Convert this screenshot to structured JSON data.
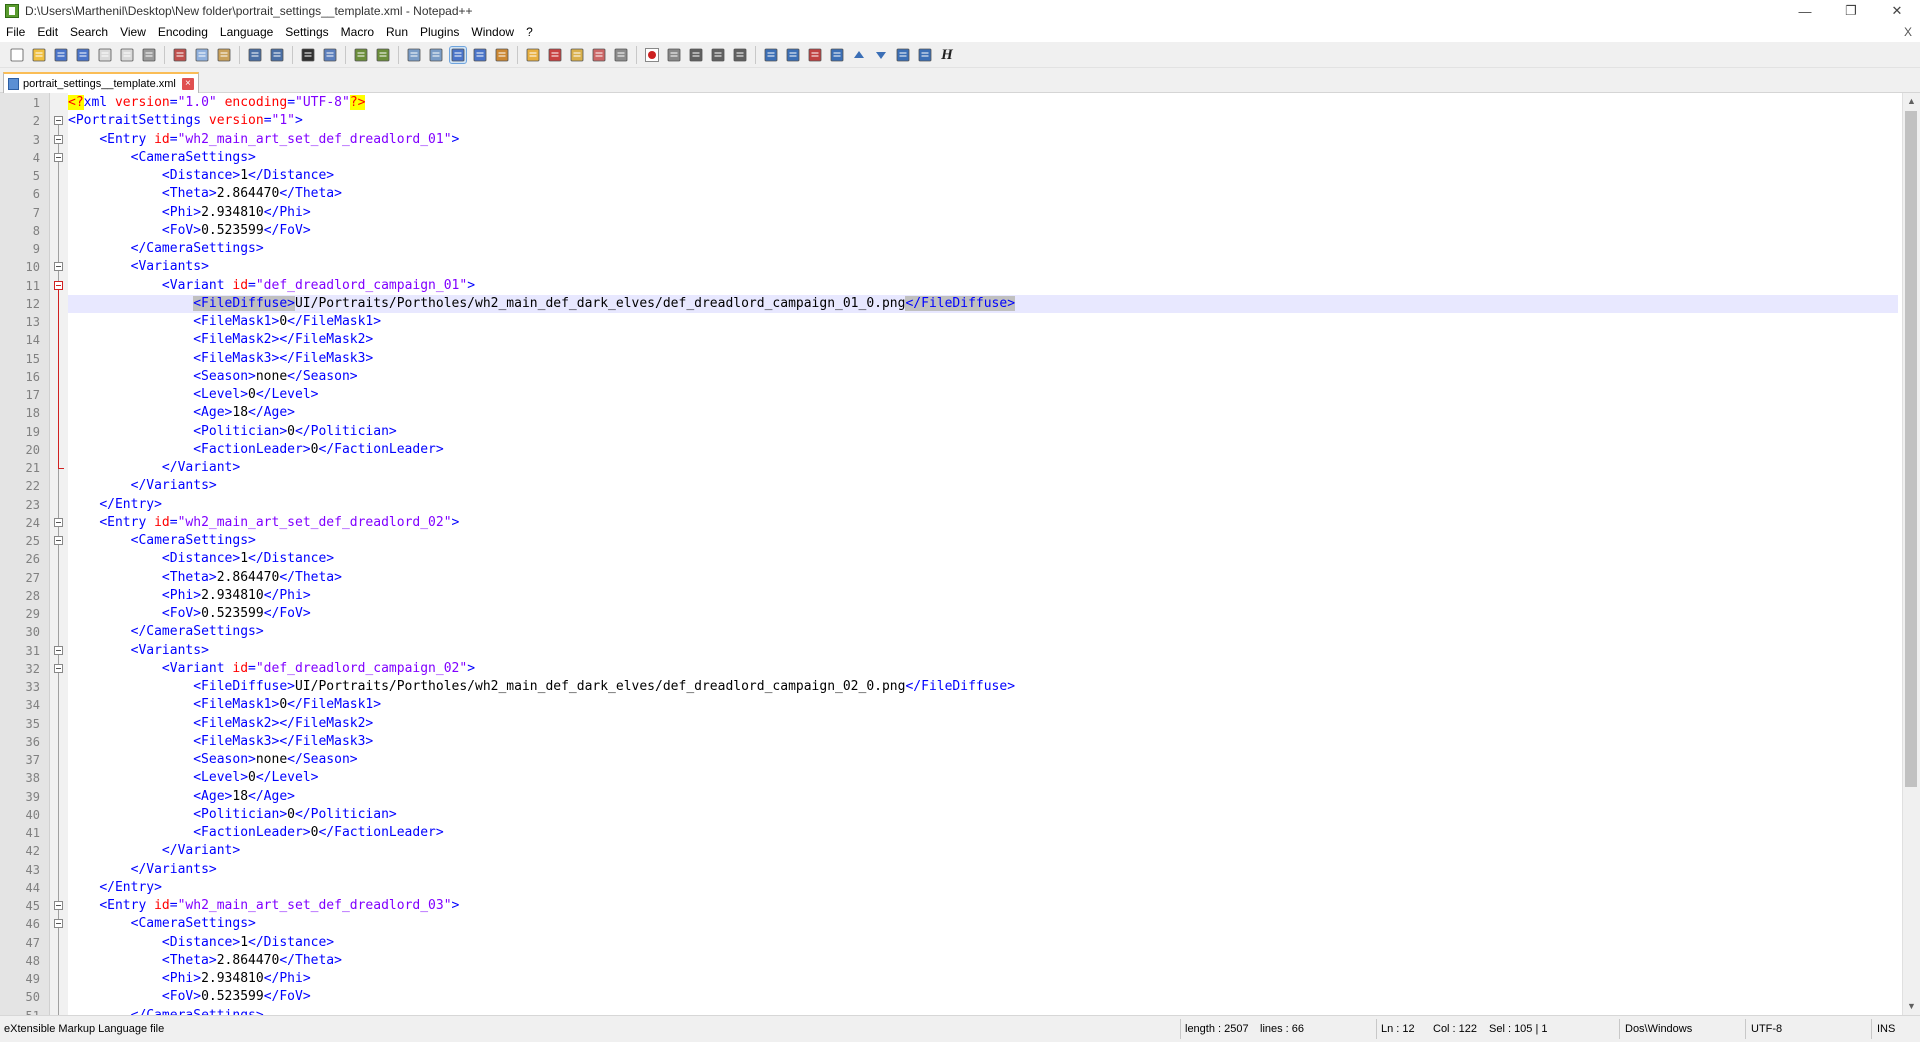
{
  "window": {
    "title": "D:\\Users\\Marthenil\\Desktop\\New folder\\portrait_settings__template.xml - Notepad++",
    "minimize_glyph": "—",
    "restore_glyph": "❐",
    "close_glyph": "✕"
  },
  "menu": {
    "items": [
      "File",
      "Edit",
      "Search",
      "View",
      "Encoding",
      "Language",
      "Settings",
      "Macro",
      "Run",
      "Plugins",
      "Window",
      "?"
    ],
    "close_glyph": "X"
  },
  "toolbar": {
    "icons": [
      "new-file-icon",
      "open-file-icon",
      "save-icon",
      "save-all-icon",
      "close-icon",
      "close-all-icon",
      "print-icon",
      "sep",
      "cut-icon",
      "copy-icon",
      "paste-icon",
      "sep",
      "undo-icon",
      "redo-icon",
      "sep",
      "find-icon",
      "replace-icon",
      "sep",
      "zoom-in-icon",
      "zoom-out-icon",
      "sep",
      "sync-vertical-icon",
      "sync-horizontal-icon",
      "word-wrap-icon",
      "show-all-chars-icon",
      "indent-guide-icon",
      "sep",
      "define-language-icon",
      "function-list-icon",
      "folder-workspace-icon",
      "document-map-icon",
      "monitor-icon",
      "sep",
      "record-macro-icon",
      "stop-record-icon",
      "play-macro-icon",
      "run-macro-multiple-icon",
      "save-macro-icon",
      "sep",
      "toolbar-icon-a",
      "toolbar-icon-b",
      "toolbar-icon-c",
      "toolbar-icon-d",
      "arrow-up-icon",
      "arrow-down-icon",
      "toolbar-icon-e",
      "toolbar-icon-f",
      "h-italic-icon"
    ],
    "pressed_icon": "word-wrap-icon",
    "h_label": "H"
  },
  "tab": {
    "label": "portrait_settings__template.xml",
    "close_glyph": "×"
  },
  "editor": {
    "current_line": 12,
    "lines": [
      {
        "n": "1",
        "t": [
          [
            "pi",
            "<?"
          ],
          [
            "tag",
            "xml "
          ],
          [
            "attr",
            "version"
          ],
          [
            "tag",
            "="
          ],
          [
            "val",
            "\"1.0\""
          ],
          [
            "tag",
            " "
          ],
          [
            "attr",
            "encoding"
          ],
          [
            "tag",
            "="
          ],
          [
            "val",
            "\"UTF-8\""
          ],
          [
            "pi",
            "?>"
          ]
        ]
      },
      {
        "n": "2",
        "t": [
          [
            "tag",
            "<PortraitSettings "
          ],
          [
            "attr",
            "version"
          ],
          [
            "tag",
            "="
          ],
          [
            "val",
            "\"1\""
          ],
          [
            "tag",
            ">"
          ]
        ]
      },
      {
        "n": "3",
        "t": [
          [
            "text",
            "    "
          ],
          [
            "tag",
            "<Entry "
          ],
          [
            "attr",
            "id"
          ],
          [
            "tag",
            "="
          ],
          [
            "val",
            "\"wh2_main_art_set_def_dreadlord_01\""
          ],
          [
            "tag",
            ">"
          ]
        ]
      },
      {
        "n": "4",
        "t": [
          [
            "text",
            "        "
          ],
          [
            "tag",
            "<CameraSettings>"
          ]
        ]
      },
      {
        "n": "5",
        "t": [
          [
            "text",
            "            "
          ],
          [
            "tag",
            "<Distance>"
          ],
          [
            "text",
            "1"
          ],
          [
            "tag",
            "</Distance>"
          ]
        ]
      },
      {
        "n": "6",
        "t": [
          [
            "text",
            "            "
          ],
          [
            "tag",
            "<Theta>"
          ],
          [
            "text",
            "2.864470"
          ],
          [
            "tag",
            "</Theta>"
          ]
        ]
      },
      {
        "n": "7",
        "t": [
          [
            "text",
            "            "
          ],
          [
            "tag",
            "<Phi>"
          ],
          [
            "text",
            "2.934810"
          ],
          [
            "tag",
            "</Phi>"
          ]
        ]
      },
      {
        "n": "8",
        "t": [
          [
            "text",
            "            "
          ],
          [
            "tag",
            "<FoV>"
          ],
          [
            "text",
            "0.523599"
          ],
          [
            "tag",
            "</FoV>"
          ]
        ]
      },
      {
        "n": "9",
        "t": [
          [
            "text",
            "        "
          ],
          [
            "tag",
            "</CameraSettings>"
          ]
        ]
      },
      {
        "n": "10",
        "t": [
          [
            "text",
            "        "
          ],
          [
            "tag",
            "<Variants>"
          ]
        ]
      },
      {
        "n": "11",
        "t": [
          [
            "text",
            "            "
          ],
          [
            "tag",
            "<Variant "
          ],
          [
            "attr",
            "id"
          ],
          [
            "tag",
            "="
          ],
          [
            "val",
            "\"def_dreadlord_campaign_01\""
          ],
          [
            "tag",
            ">"
          ]
        ]
      },
      {
        "n": "12",
        "t": [
          [
            "text",
            "                "
          ],
          [
            "seltag",
            "<FileDiffuse>"
          ],
          [
            "text",
            "UI/Portraits/Portholes/wh2_main_def_dark_elves/def_dreadlord_campaign_01_0.png"
          ],
          [
            "seltag",
            "</FileDiffuse>"
          ]
        ]
      },
      {
        "n": "13",
        "t": [
          [
            "text",
            "                "
          ],
          [
            "tag",
            "<FileMask1>"
          ],
          [
            "text",
            "0"
          ],
          [
            "tag",
            "</FileMask1>"
          ]
        ]
      },
      {
        "n": "14",
        "t": [
          [
            "text",
            "                "
          ],
          [
            "tag",
            "<FileMask2>"
          ],
          [
            "tag",
            "</FileMask2>"
          ]
        ]
      },
      {
        "n": "15",
        "t": [
          [
            "text",
            "                "
          ],
          [
            "tag",
            "<FileMask3>"
          ],
          [
            "tag",
            "</FileMask3>"
          ]
        ]
      },
      {
        "n": "16",
        "t": [
          [
            "text",
            "                "
          ],
          [
            "tag",
            "<Season>"
          ],
          [
            "text",
            "none"
          ],
          [
            "tag",
            "</Season>"
          ]
        ]
      },
      {
        "n": "17",
        "t": [
          [
            "text",
            "                "
          ],
          [
            "tag",
            "<Level>"
          ],
          [
            "text",
            "0"
          ],
          [
            "tag",
            "</Level>"
          ]
        ]
      },
      {
        "n": "18",
        "t": [
          [
            "text",
            "                "
          ],
          [
            "tag",
            "<Age>"
          ],
          [
            "text",
            "18"
          ],
          [
            "tag",
            "</Age>"
          ]
        ]
      },
      {
        "n": "19",
        "t": [
          [
            "text",
            "                "
          ],
          [
            "tag",
            "<Politician>"
          ],
          [
            "text",
            "0"
          ],
          [
            "tag",
            "</Politician>"
          ]
        ]
      },
      {
        "n": "20",
        "t": [
          [
            "text",
            "                "
          ],
          [
            "tag",
            "<FactionLeader>"
          ],
          [
            "text",
            "0"
          ],
          [
            "tag",
            "</FactionLeader>"
          ]
        ]
      },
      {
        "n": "21",
        "t": [
          [
            "text",
            "            "
          ],
          [
            "tag",
            "</Variant>"
          ]
        ]
      },
      {
        "n": "22",
        "t": [
          [
            "text",
            "        "
          ],
          [
            "tag",
            "</Variants>"
          ]
        ]
      },
      {
        "n": "23",
        "t": [
          [
            "text",
            "    "
          ],
          [
            "tag",
            "</Entry>"
          ]
        ]
      },
      {
        "n": "24",
        "t": [
          [
            "text",
            "    "
          ],
          [
            "tag",
            "<Entry "
          ],
          [
            "attr",
            "id"
          ],
          [
            "tag",
            "="
          ],
          [
            "val",
            "\"wh2_main_art_set_def_dreadlord_02\""
          ],
          [
            "tag",
            ">"
          ]
        ]
      },
      {
        "n": "25",
        "t": [
          [
            "text",
            "        "
          ],
          [
            "tag",
            "<CameraSettings>"
          ]
        ]
      },
      {
        "n": "26",
        "t": [
          [
            "text",
            "            "
          ],
          [
            "tag",
            "<Distance>"
          ],
          [
            "text",
            "1"
          ],
          [
            "tag",
            "</Distance>"
          ]
        ]
      },
      {
        "n": "27",
        "t": [
          [
            "text",
            "            "
          ],
          [
            "tag",
            "<Theta>"
          ],
          [
            "text",
            "2.864470"
          ],
          [
            "tag",
            "</Theta>"
          ]
        ]
      },
      {
        "n": "28",
        "t": [
          [
            "text",
            "            "
          ],
          [
            "tag",
            "<Phi>"
          ],
          [
            "text",
            "2.934810"
          ],
          [
            "tag",
            "</Phi>"
          ]
        ]
      },
      {
        "n": "29",
        "t": [
          [
            "text",
            "            "
          ],
          [
            "tag",
            "<FoV>"
          ],
          [
            "text",
            "0.523599"
          ],
          [
            "tag",
            "</FoV>"
          ]
        ]
      },
      {
        "n": "30",
        "t": [
          [
            "text",
            "        "
          ],
          [
            "tag",
            "</CameraSettings>"
          ]
        ]
      },
      {
        "n": "31",
        "t": [
          [
            "text",
            "        "
          ],
          [
            "tag",
            "<Variants>"
          ]
        ]
      },
      {
        "n": "32",
        "t": [
          [
            "text",
            "            "
          ],
          [
            "tag",
            "<Variant "
          ],
          [
            "attr",
            "id"
          ],
          [
            "tag",
            "="
          ],
          [
            "val",
            "\"def_dreadlord_campaign_02\""
          ],
          [
            "tag",
            ">"
          ]
        ]
      },
      {
        "n": "33",
        "t": [
          [
            "text",
            "                "
          ],
          [
            "tag",
            "<FileDiffuse>"
          ],
          [
            "text",
            "UI/Portraits/Portholes/wh2_main_def_dark_elves/def_dreadlord_campaign_02_0.png"
          ],
          [
            "tag",
            "</FileDiffuse>"
          ]
        ]
      },
      {
        "n": "34",
        "t": [
          [
            "text",
            "                "
          ],
          [
            "tag",
            "<FileMask1>"
          ],
          [
            "text",
            "0"
          ],
          [
            "tag",
            "</FileMask1>"
          ]
        ]
      },
      {
        "n": "35",
        "t": [
          [
            "text",
            "                "
          ],
          [
            "tag",
            "<FileMask2>"
          ],
          [
            "tag",
            "</FileMask2>"
          ]
        ]
      },
      {
        "n": "36",
        "t": [
          [
            "text",
            "                "
          ],
          [
            "tag",
            "<FileMask3>"
          ],
          [
            "tag",
            "</FileMask3>"
          ]
        ]
      },
      {
        "n": "37",
        "t": [
          [
            "text",
            "                "
          ],
          [
            "tag",
            "<Season>"
          ],
          [
            "text",
            "none"
          ],
          [
            "tag",
            "</Season>"
          ]
        ]
      },
      {
        "n": "38",
        "t": [
          [
            "text",
            "                "
          ],
          [
            "tag",
            "<Level>"
          ],
          [
            "text",
            "0"
          ],
          [
            "tag",
            "</Level>"
          ]
        ]
      },
      {
        "n": "39",
        "t": [
          [
            "text",
            "                "
          ],
          [
            "tag",
            "<Age>"
          ],
          [
            "text",
            "18"
          ],
          [
            "tag",
            "</Age>"
          ]
        ]
      },
      {
        "n": "40",
        "t": [
          [
            "text",
            "                "
          ],
          [
            "tag",
            "<Politician>"
          ],
          [
            "text",
            "0"
          ],
          [
            "tag",
            "</Politician>"
          ]
        ]
      },
      {
        "n": "41",
        "t": [
          [
            "text",
            "                "
          ],
          [
            "tag",
            "<FactionLeader>"
          ],
          [
            "text",
            "0"
          ],
          [
            "tag",
            "</FactionLeader>"
          ]
        ]
      },
      {
        "n": "42",
        "t": [
          [
            "text",
            "            "
          ],
          [
            "tag",
            "</Variant>"
          ]
        ]
      },
      {
        "n": "43",
        "t": [
          [
            "text",
            "        "
          ],
          [
            "tag",
            "</Variants>"
          ]
        ]
      },
      {
        "n": "44",
        "t": [
          [
            "text",
            "    "
          ],
          [
            "tag",
            "</Entry>"
          ]
        ]
      },
      {
        "n": "45",
        "t": [
          [
            "text",
            "    "
          ],
          [
            "tag",
            "<Entry "
          ],
          [
            "attr",
            "id"
          ],
          [
            "tag",
            "="
          ],
          [
            "val",
            "\"wh2_main_art_set_def_dreadlord_03\""
          ],
          [
            "tag",
            ">"
          ]
        ]
      },
      {
        "n": "46",
        "t": [
          [
            "text",
            "        "
          ],
          [
            "tag",
            "<CameraSettings>"
          ]
        ]
      },
      {
        "n": "47",
        "t": [
          [
            "text",
            "            "
          ],
          [
            "tag",
            "<Distance>"
          ],
          [
            "text",
            "1"
          ],
          [
            "tag",
            "</Distance>"
          ]
        ]
      },
      {
        "n": "48",
        "t": [
          [
            "text",
            "            "
          ],
          [
            "tag",
            "<Theta>"
          ],
          [
            "text",
            "2.864470"
          ],
          [
            "tag",
            "</Theta>"
          ]
        ]
      },
      {
        "n": "49",
        "t": [
          [
            "text",
            "            "
          ],
          [
            "tag",
            "<Phi>"
          ],
          [
            "text",
            "2.934810"
          ],
          [
            "tag",
            "</Phi>"
          ]
        ]
      },
      {
        "n": "50",
        "t": [
          [
            "text",
            "            "
          ],
          [
            "tag",
            "<FoV>"
          ],
          [
            "text",
            "0.523599"
          ],
          [
            "tag",
            "</FoV>"
          ]
        ]
      },
      {
        "n": "51",
        "t": [
          [
            "text",
            "        "
          ],
          [
            "tag",
            "</CameraSettings>"
          ]
        ]
      }
    ],
    "fold_markers": [
      2,
      3,
      4,
      10,
      11,
      24,
      25,
      31,
      32,
      45,
      46
    ],
    "red_fold_marker": 11,
    "red_fold_range": [
      11,
      21
    ]
  },
  "scrollbar": {
    "up_glyph": "▲",
    "down_glyph": "▼"
  },
  "status": {
    "file_type": "eXtensible Markup Language file",
    "length": "length : 2507",
    "lines": "lines : 66",
    "ln": "Ln : 12",
    "col": "Col : 122",
    "sel": "Sel : 105 | 1",
    "eol": "Dos\\Windows",
    "encoding": "UTF-8",
    "mode": "INS"
  },
  "colors": {
    "tag": "#0000ff",
    "attr": "#ff0000",
    "value": "#8000ff",
    "text": "#000000",
    "pi_bg": "#ffff00",
    "current_line": "#e8e8ff",
    "tab_accent": "#fabd56"
  }
}
